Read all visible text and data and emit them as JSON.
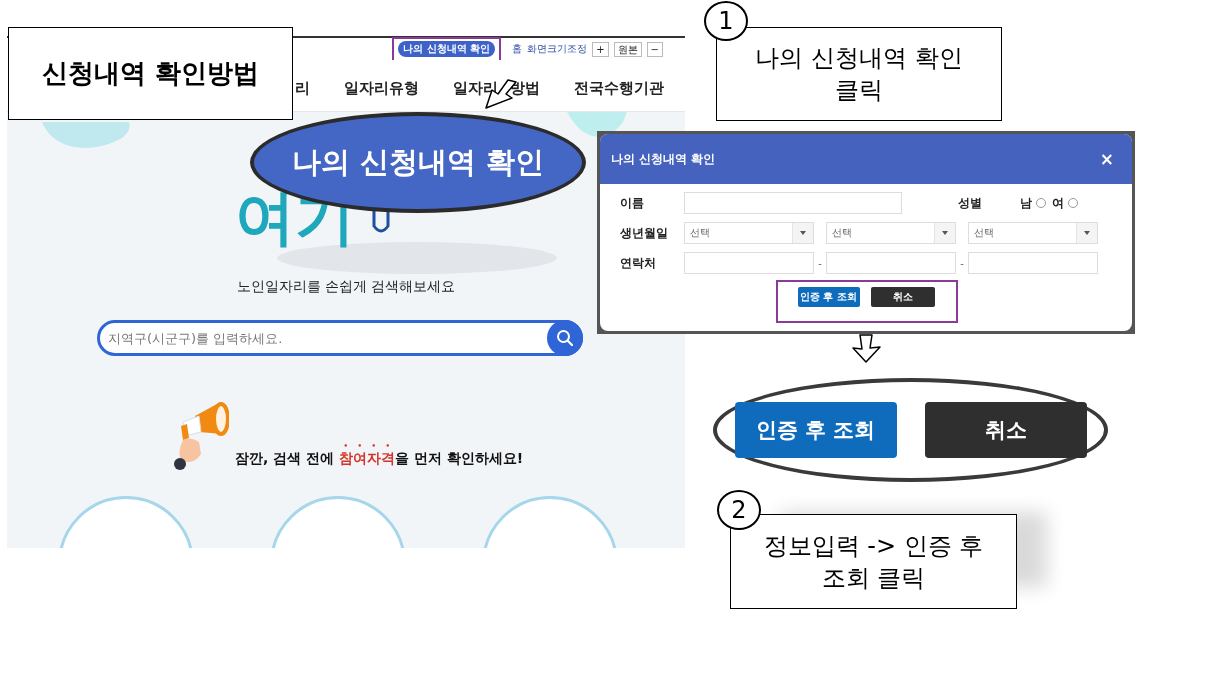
{
  "title_card": {
    "text": "신청내역 확인방법"
  },
  "site": {
    "top_bar": {
      "history_button": "나의 신청내역 확인",
      "home_link": "홈",
      "zoom_label": "화면크기조정",
      "zoom_buttons": [
        "+",
        "원본",
        "−"
      ]
    },
    "nav": [
      {
        "text": "리",
        "kind": "item"
      },
      {
        "text": "일자리유형",
        "kind": "item"
      },
      {
        "text": "일자리",
        "kind": "part"
      },
      {
        "text": "방법",
        "kind": "item"
      },
      {
        "text": "전국수행기관",
        "kind": "item"
      }
    ],
    "hero_word": "여기",
    "tagline": "노인일자리를 손쉽게 검색해보세요",
    "search": {
      "placeholder": "지역구(시군구)를 입력하세요."
    },
    "notice": {
      "before": "잠깐, 검색 전에 ",
      "emphasis": "참여자격",
      "after": "을 먼저 확인하세요!"
    }
  },
  "callout_bubble": {
    "text": "나의 신청내역 확인"
  },
  "modal": {
    "title": "나의 신청내역 확인",
    "close": "×",
    "name_label": "이름",
    "gender_label": "성별",
    "gender_options": [
      {
        "label": "남",
        "selected": false
      },
      {
        "label": "여",
        "selected": false
      }
    ],
    "birth_label": "생년월일",
    "birth_selects": [
      "선택",
      "선택",
      "선택"
    ],
    "contact_label": "연락처",
    "contact_separators": [
      "-",
      "-"
    ],
    "buttons": [
      {
        "label": "인증 후 조회",
        "kind": "primary"
      },
      {
        "label": "취소",
        "kind": "dark"
      }
    ]
  },
  "zoomed_buttons": [
    {
      "label": "인증 후 조회",
      "kind": "primary"
    },
    {
      "label": "취소",
      "kind": "dark"
    }
  ],
  "steps": [
    {
      "number": "1",
      "text": "나의 신청내역 확인\n클릭"
    },
    {
      "number": "2",
      "text": "정보입력 -> 인증 후\n조회 클릭"
    }
  ]
}
